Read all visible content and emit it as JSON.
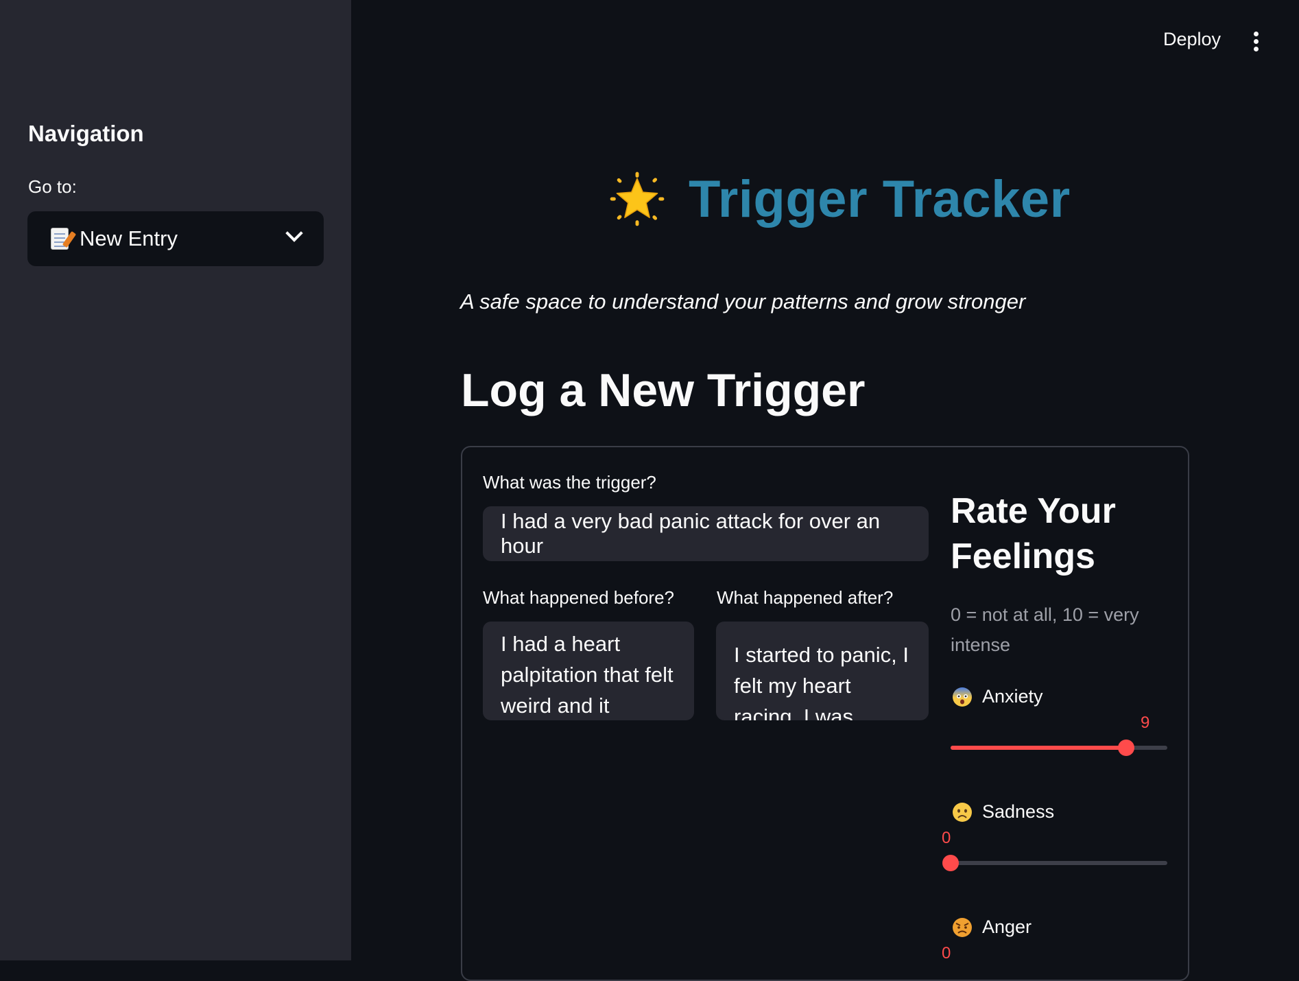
{
  "sidebar": {
    "heading": "Navigation",
    "goto_label": "Go to:",
    "select": {
      "value": "New Entry",
      "icon": "memo-icon"
    }
  },
  "header": {
    "deploy_label": "Deploy",
    "menu_icon": "kebab-menu-icon"
  },
  "main": {
    "title": "Trigger Tracker",
    "title_icon": "glowing-star-icon",
    "title_color": "#2e86ab",
    "subtitle": "A safe space to understand your patterns and grow stronger",
    "section_title": "Log a New Trigger",
    "form": {
      "trigger_label": "What was the trigger?",
      "trigger_value": "I had a very bad panic attack for over an hour",
      "before_label": "What happened before?",
      "before_value": "I had a heart palpitation that felt weird and it",
      "after_label": "What happened after?",
      "after_value": "I started to panic, I felt my heart racing. I was"
    },
    "feelings": {
      "title": "Rate Your Feelings",
      "caption": "0 = not at all, 10 = very intense",
      "scale_max": 10,
      "accent_color": "#ff4b4b",
      "items": [
        {
          "label": "Anxiety",
          "icon": "fearful-face-icon",
          "value": 9,
          "value_text": "9"
        },
        {
          "label": "Sadness",
          "icon": "frowning-face-icon",
          "value": 0,
          "value_text": "0"
        },
        {
          "label": "Anger",
          "icon": "angry-face-icon",
          "value": 0,
          "value_text": "0"
        }
      ]
    }
  }
}
